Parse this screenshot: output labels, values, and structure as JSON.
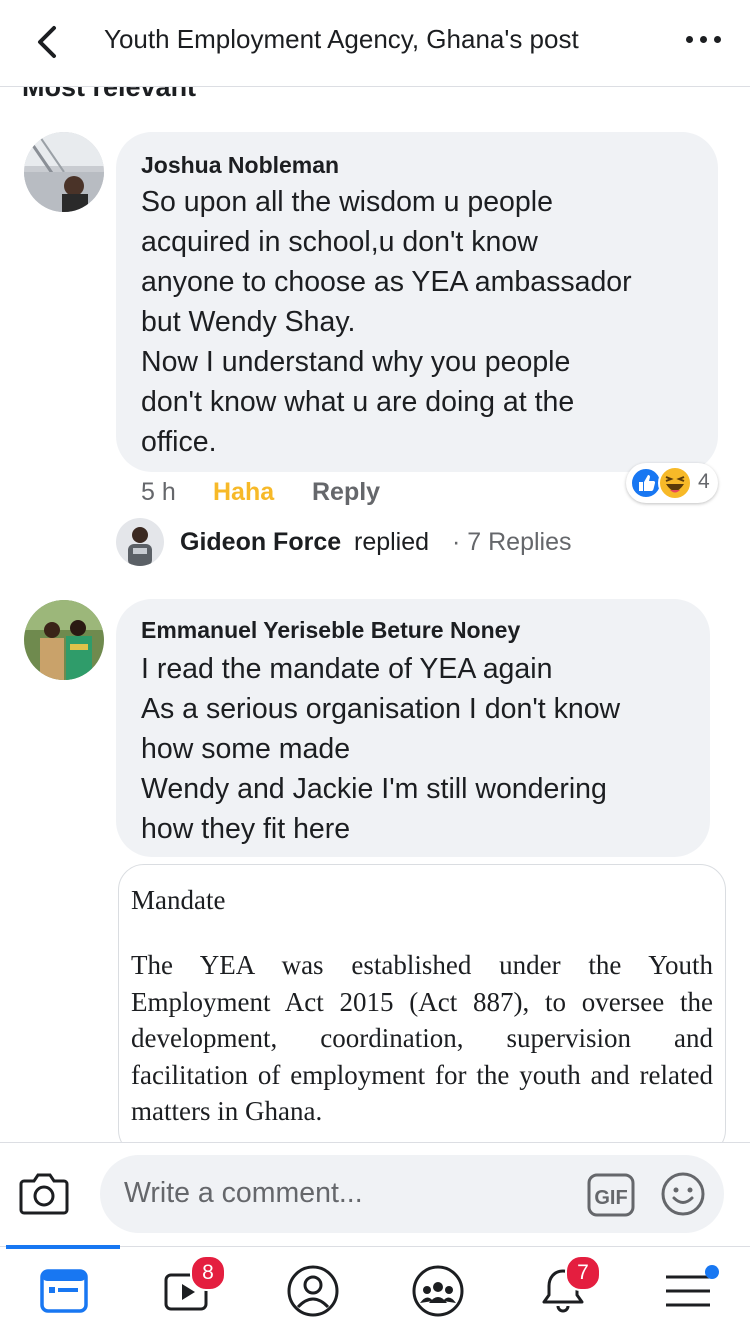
{
  "header": {
    "title": "Youth Employment Agency, Ghana's post"
  },
  "sort": {
    "label": "Most relevant"
  },
  "comments": [
    {
      "author": "Joshua Nobleman",
      "lines": [
        "So upon all the wisdom u people",
        "acquired in school,u don't know",
        "anyone to choose as YEA ambassador",
        "but Wendy Shay.",
        "Now I understand why you people",
        "don't know what u are doing at the",
        "office."
      ],
      "time": "5 h",
      "reaction_label": "Haha",
      "reply_label": "Reply",
      "reaction_count": "4",
      "reply_preview": {
        "name": "Gideon Force",
        "verb": "replied",
        "count": "· 7 Replies"
      }
    },
    {
      "author": "Emmanuel Yeriseble Beture Noney",
      "lines": [
        "I read the mandate of YEA again",
        "As a serious organisation I don't know",
        "how some made",
        "Wendy and Jackie I'm still wondering",
        "how they fit here"
      ],
      "attachment": {
        "title": "Mandate",
        "text": "The YEA was established under the Youth Employment Act 2015 (Act 887), to oversee the development, coordination, supervision and facilitation of employment for the youth and related matters in Ghana."
      }
    }
  ],
  "composer": {
    "placeholder": "Write a comment...",
    "gif_label": "GIF"
  },
  "tabbar": {
    "watch_badge": "8",
    "notifications_badge": "7"
  },
  "colors": {
    "accent": "#1877f2",
    "haha": "#f7b928",
    "badge": "#e41e3f",
    "bubble": "#f0f2f5"
  }
}
